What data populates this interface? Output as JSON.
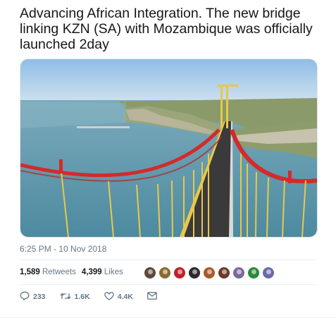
{
  "tweet": {
    "text": "Advancing African Integration. The new bridge linking KZN  (SA) with Mozambique was officially launched 2day",
    "timestamp": "6:25 PM - 10 Nov 2018"
  },
  "stats": {
    "retweets_count": "1,589",
    "retweets_label": "Retweets",
    "likes_count": "4,399",
    "likes_label": "Likes"
  },
  "avatars": [
    {
      "name": "avatar-1",
      "color": "#5b4a3a"
    },
    {
      "name": "avatar-2",
      "color": "#8a6a2e"
    },
    {
      "name": "avatar-3",
      "color": "#c0202a"
    },
    {
      "name": "avatar-4",
      "color": "#2a2a2a"
    },
    {
      "name": "avatar-5",
      "color": "#a85a2a"
    },
    {
      "name": "avatar-6",
      "color": "#6b3a2a"
    },
    {
      "name": "avatar-7",
      "color": "#7a6a9a"
    },
    {
      "name": "avatar-8",
      "color": "#2a8a3a"
    },
    {
      "name": "avatar-9",
      "color": "#6a6aaa"
    }
  ],
  "actions": {
    "reply": {
      "icon": "reply-icon",
      "count": "233"
    },
    "retweet": {
      "icon": "retweet-icon",
      "count": "1.6K"
    },
    "like": {
      "icon": "heart-icon",
      "count": "4.4K"
    },
    "message": {
      "icon": "envelope-icon"
    }
  },
  "colors": {
    "bridge_red": "#d42a2a",
    "cable_yellow": "#e8c84a",
    "sky": "#9fc7e8",
    "water": "#5f98ad",
    "text_secondary": "#657786"
  }
}
